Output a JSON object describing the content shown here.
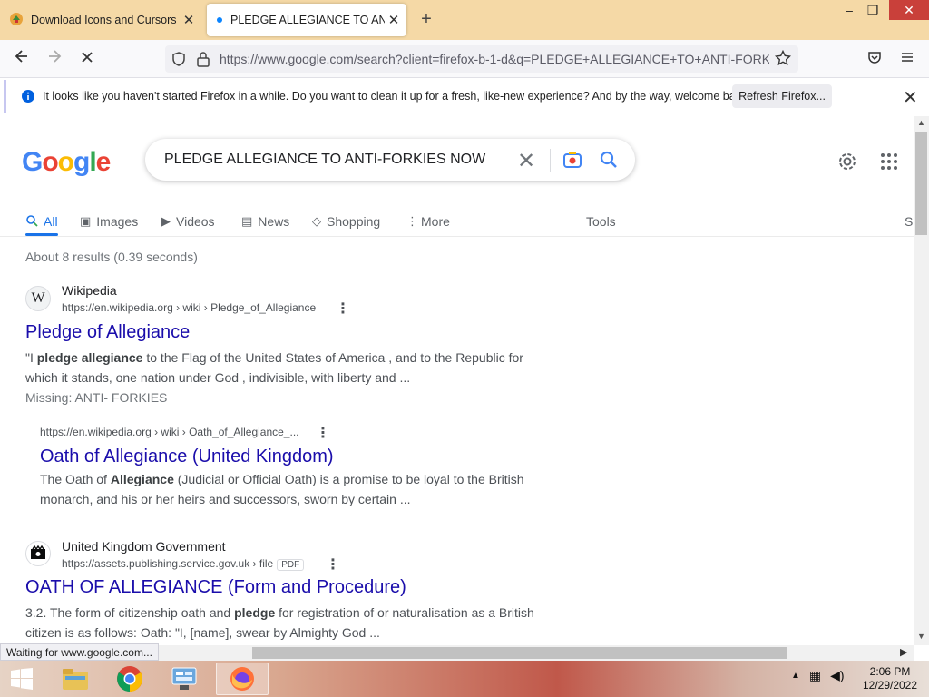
{
  "browser": {
    "tabs": [
      {
        "label": "Download Icons and Cursors",
        "icon": "download-site-favicon"
      },
      {
        "label": "PLEDGE ALLEGIANCE TO ANTI-F",
        "icon": "loading-dot",
        "active": true
      }
    ],
    "url": "https://www.google.com/search?client=firefox-b-1-d&q=PLEDGE+ALLEGIANCE+TO+ANTI-FORKIES+NOW",
    "url_domain": "www.google.com",
    "notification": {
      "text": "It looks like you haven't started Firefox in a while. Do you want to clean it up for a fresh, like-new experience? And by the way, welcome back!",
      "button": "Refresh Firefox..."
    },
    "status": "Waiting for www.google.com..."
  },
  "google": {
    "logo": "Google",
    "query": "PLEDGE ALLEGIANCE TO ANTI-FORKIES NOW",
    "tabs": [
      "All",
      "Images",
      "Videos",
      "News",
      "Shopping",
      "More"
    ],
    "tools": "Tools",
    "safesearch_partial": "S",
    "stats": "About 8 results (0.39 seconds)"
  },
  "results": [
    {
      "site_name": "Wikipedia",
      "url": "https://en.wikipedia.org › wiki › Pledge_of_Allegiance",
      "title": "Pledge of Allegiance",
      "snippet_pre": "\"I ",
      "snippet_bold": "pledge allegiance",
      "snippet_post": " to the Flag of the United States of America , and to the Republic for which it stands, one nation under God , indivisible, with liberty and ...",
      "missing_label": "Missing: ",
      "missing_terms": [
        "ANTI-",
        "FORKIES"
      ]
    },
    {
      "url": "https://en.wikipedia.org › wiki › Oath_of_Allegiance_...",
      "title": "Oath of Allegiance (United Kingdom)",
      "snippet_pre": "The Oath of ",
      "snippet_bold": "Allegiance",
      "snippet_post": " (Judicial or Official Oath) is a promise to be loyal to the British monarch, and his or her heirs and successors, sworn by certain ..."
    },
    {
      "site_name": "United Kingdom Government",
      "url": "https://assets.publishing.service.gov.uk › file",
      "badge": "PDF",
      "title": "OATH OF ALLEGIANCE (Form and Procedure)",
      "snippet_pre": "3.2. The form of citizenship oath and ",
      "snippet_bold": "pledge",
      "snippet_post": " for registration of or naturalisation as a British citizen is as follows: Oath: \"I, [name], swear by Almighty God ..."
    }
  ],
  "taskbar": {
    "time": "2:06 PM",
    "date": "12/29/2022"
  }
}
